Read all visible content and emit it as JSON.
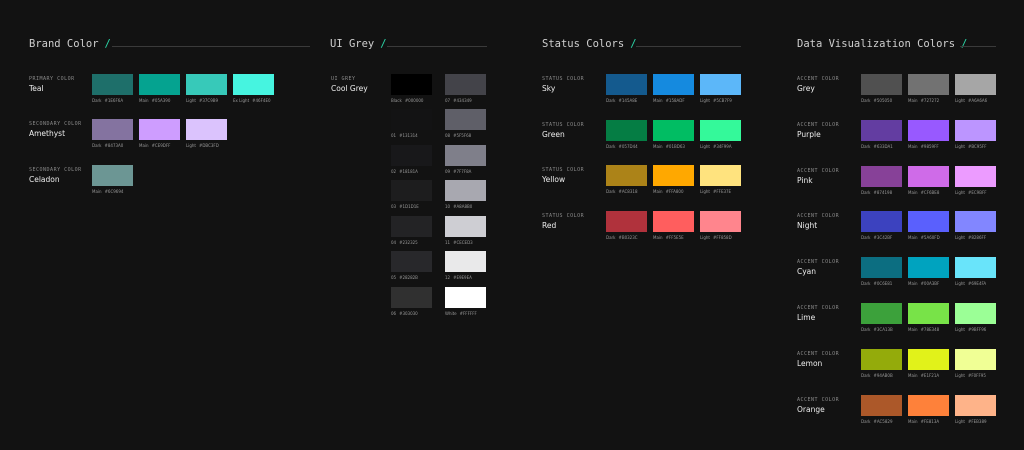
{
  "sections": {
    "brand": {
      "title": "Brand Color"
    },
    "grey": {
      "title": "UI Grey"
    },
    "status": {
      "title": "Status Colors"
    },
    "dataviz": {
      "title": "Data Visualization Colors"
    }
  },
  "brand": [
    {
      "label": "PRIMARY COLOR",
      "name": "Teal",
      "swatches": [
        {
          "key": "Dark",
          "hex": "#1E6F6A",
          "color": "#1E6F6A"
        },
        {
          "key": "Main",
          "hex": "#05A390",
          "color": "#05A390"
        },
        {
          "key": "Light",
          "hex": "#37C9B9",
          "color": "#37C9B9"
        },
        {
          "key": "Ex Light",
          "hex": "#46F4E0",
          "color": "#46F4E0"
        }
      ]
    },
    {
      "label": "SECONDARY COLOR",
      "name": "Amethyst",
      "swatches": [
        {
          "key": "Dark",
          "hex": "#8473A0",
          "color": "#8473A0"
        },
        {
          "key": "Main",
          "hex": "#CE9DFF",
          "color": "#CE9DFF"
        },
        {
          "key": "Light",
          "hex": "#DBC3FD",
          "color": "#DBC3FD"
        }
      ]
    },
    {
      "label": "SECONDARY COLOR",
      "name": "Celadon",
      "swatches": [
        {
          "key": "Main",
          "hex": "#6C9694",
          "color": "#6C9694"
        }
      ]
    }
  ],
  "grey": {
    "label": "UI GREY",
    "name": "Cool Grey",
    "col1": [
      {
        "key": "Black",
        "hex": "#000000",
        "color": "#000000"
      },
      {
        "key": "01",
        "hex": "#131314",
        "color": "#131314"
      },
      {
        "key": "02",
        "hex": "#18181A",
        "color": "#18181A"
      },
      {
        "key": "03",
        "hex": "#1D1D1E",
        "color": "#1D1D1E"
      },
      {
        "key": "04",
        "hex": "#232325",
        "color": "#232325"
      },
      {
        "key": "05",
        "hex": "#28282B",
        "color": "#28282B"
      },
      {
        "key": "06",
        "hex": "#303030",
        "color": "#303030"
      }
    ],
    "col2": [
      {
        "key": "07",
        "hex": "#434349",
        "color": "#434349"
      },
      {
        "key": "08",
        "hex": "#5F5F68",
        "color": "#5F5F68"
      },
      {
        "key": "09",
        "hex": "#7F7F8A",
        "color": "#7F7F8A"
      },
      {
        "key": "10",
        "hex": "#A8A8B0",
        "color": "#A8A8B0"
      },
      {
        "key": "11",
        "hex": "#CECED3",
        "color": "#CECED3"
      },
      {
        "key": "12",
        "hex": "#E9E9EA",
        "color": "#E9E9EA"
      },
      {
        "key": "White",
        "hex": "#FFFFFF",
        "color": "#FFFFFF"
      }
    ]
  },
  "status": [
    {
      "label": "STATUS COLOR",
      "name": "Sky",
      "swatches": [
        {
          "key": "Dark",
          "hex": "#145A8E",
          "color": "#145A8E"
        },
        {
          "key": "Main",
          "hex": "#158ADF",
          "color": "#158ADF"
        },
        {
          "key": "Light",
          "hex": "#5CB7F9",
          "color": "#5CB7F9"
        }
      ]
    },
    {
      "label": "STATUS COLOR",
      "name": "Green",
      "swatches": [
        {
          "key": "Dark",
          "hex": "#057D44",
          "color": "#057D44"
        },
        {
          "key": "Main",
          "hex": "#01BD63",
          "color": "#01BD63"
        },
        {
          "key": "Light",
          "hex": "#34F99A",
          "color": "#34F99A"
        }
      ]
    },
    {
      "label": "STATUS COLOR",
      "name": "Yellow",
      "swatches": [
        {
          "key": "Dark",
          "hex": "#AC8318",
          "color": "#AC8318"
        },
        {
          "key": "Main",
          "hex": "#FFA800",
          "color": "#FFA800"
        },
        {
          "key": "Light",
          "hex": "#FFE37E",
          "color": "#FFE37E"
        }
      ]
    },
    {
      "label": "STATUS COLOR",
      "name": "Red",
      "swatches": [
        {
          "key": "Dark",
          "hex": "#B0323C",
          "color": "#B0323C"
        },
        {
          "key": "Main",
          "hex": "#FF5E5E",
          "color": "#FF5E5E"
        },
        {
          "key": "Light",
          "hex": "#FF858D",
          "color": "#FF858D"
        }
      ]
    }
  ],
  "dataviz": [
    {
      "label": "ACCENT COLOR",
      "name": "Grey",
      "swatches": [
        {
          "key": "Dark",
          "hex": "#505050",
          "color": "#505050"
        },
        {
          "key": "Main",
          "hex": "#727272",
          "color": "#727272"
        },
        {
          "key": "Light",
          "hex": "#A6A6A6",
          "color": "#A6A6A6"
        }
      ]
    },
    {
      "label": "ACCENT COLOR",
      "name": "Purple",
      "swatches": [
        {
          "key": "Dark",
          "hex": "#633DA1",
          "color": "#633DA1"
        },
        {
          "key": "Main",
          "hex": "#9859FF",
          "color": "#9859FF"
        },
        {
          "key": "Light",
          "hex": "#BC95FF",
          "color": "#BC95FF"
        }
      ]
    },
    {
      "label": "ACCENT COLOR",
      "name": "Pink",
      "swatches": [
        {
          "key": "Dark",
          "hex": "#874198",
          "color": "#874198"
        },
        {
          "key": "Main",
          "hex": "#CF6BE8",
          "color": "#CF6BE8"
        },
        {
          "key": "Light",
          "hex": "#EC9BFF",
          "color": "#EC9BFF"
        }
      ]
    },
    {
      "label": "ACCENT COLOR",
      "name": "Night",
      "swatches": [
        {
          "key": "Dark",
          "hex": "#3C42BF",
          "color": "#3C42BF"
        },
        {
          "key": "Main",
          "hex": "#5A60FD",
          "color": "#5A60FD"
        },
        {
          "key": "Light",
          "hex": "#8286FF",
          "color": "#8286FF"
        }
      ]
    },
    {
      "label": "ACCENT COLOR",
      "name": "Cyan",
      "swatches": [
        {
          "key": "Dark",
          "hex": "#0C6E81",
          "color": "#0C6E81"
        },
        {
          "key": "Main",
          "hex": "#00A3BF",
          "color": "#00A3BF"
        },
        {
          "key": "Light",
          "hex": "#69E4FA",
          "color": "#69E4FA"
        }
      ]
    },
    {
      "label": "ACCENT COLOR",
      "name": "Lime",
      "swatches": [
        {
          "key": "Dark",
          "hex": "#3CA13B",
          "color": "#3CA13B"
        },
        {
          "key": "Main",
          "hex": "#78E348",
          "color": "#78E348"
        },
        {
          "key": "Light",
          "hex": "#9BFF96",
          "color": "#9BFF96"
        }
      ]
    },
    {
      "label": "ACCENT COLOR",
      "name": "Lemon",
      "swatches": [
        {
          "key": "Dark",
          "hex": "#94AB0B",
          "color": "#94AB0B"
        },
        {
          "key": "Main",
          "hex": "#E1F21A",
          "color": "#E1F21A"
        },
        {
          "key": "Light",
          "hex": "#F0FF95",
          "color": "#F0FF95"
        }
      ]
    },
    {
      "label": "ACCENT COLOR",
      "name": "Orange",
      "swatches": [
        {
          "key": "Dark",
          "hex": "#AC5829",
          "color": "#AC5829"
        },
        {
          "key": "Main",
          "hex": "#FE813A",
          "color": "#FE813A"
        },
        {
          "key": "Light",
          "hex": "#FEB389",
          "color": "#FEB389"
        }
      ]
    }
  ]
}
